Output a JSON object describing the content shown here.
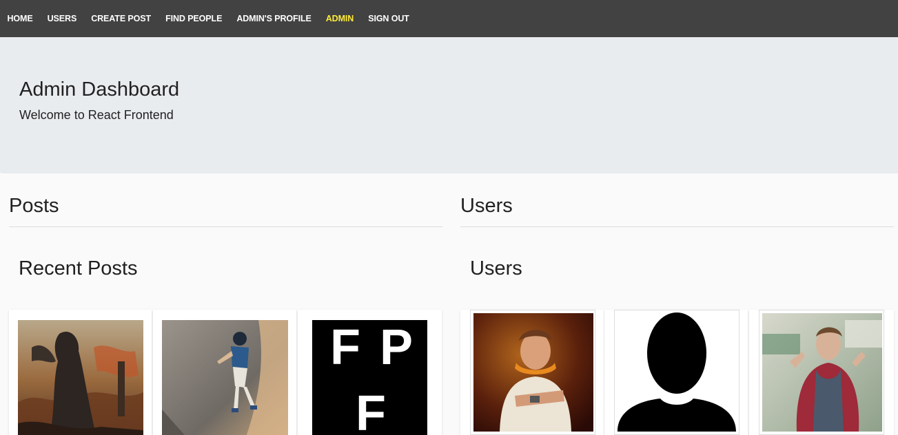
{
  "nav": {
    "items": [
      {
        "label": "HOME",
        "active": false
      },
      {
        "label": "USERS",
        "active": false
      },
      {
        "label": "CREATE POST",
        "active": false
      },
      {
        "label": "FIND PEOPLE",
        "active": false
      },
      {
        "label": "ADMIN'S PROFILE",
        "active": false
      },
      {
        "label": "ADMIN",
        "active": true
      },
      {
        "label": "SIGN OUT",
        "active": false
      }
    ],
    "active_color": "#ffeb3b",
    "bg_color": "#424242"
  },
  "jumbotron": {
    "title": "Admin Dashboard",
    "lead": "Welcome to React Frontend"
  },
  "posts_column": {
    "heading": "Posts",
    "sub_heading": "Recent Posts",
    "cards": [
      {
        "image": "fantasy-warrior-painting"
      },
      {
        "image": "climbing-figurine-photo"
      },
      {
        "image": "fpf-logo",
        "logo_letters": [
          "F",
          "P",
          "F"
        ]
      }
    ]
  },
  "users_column": {
    "heading": "Users",
    "sub_heading": "Users",
    "cards": [
      {
        "image": "user-photo-headphones"
      },
      {
        "image": "default-avatar-silhouette"
      },
      {
        "image": "user-photo-red-hoodie"
      }
    ]
  }
}
